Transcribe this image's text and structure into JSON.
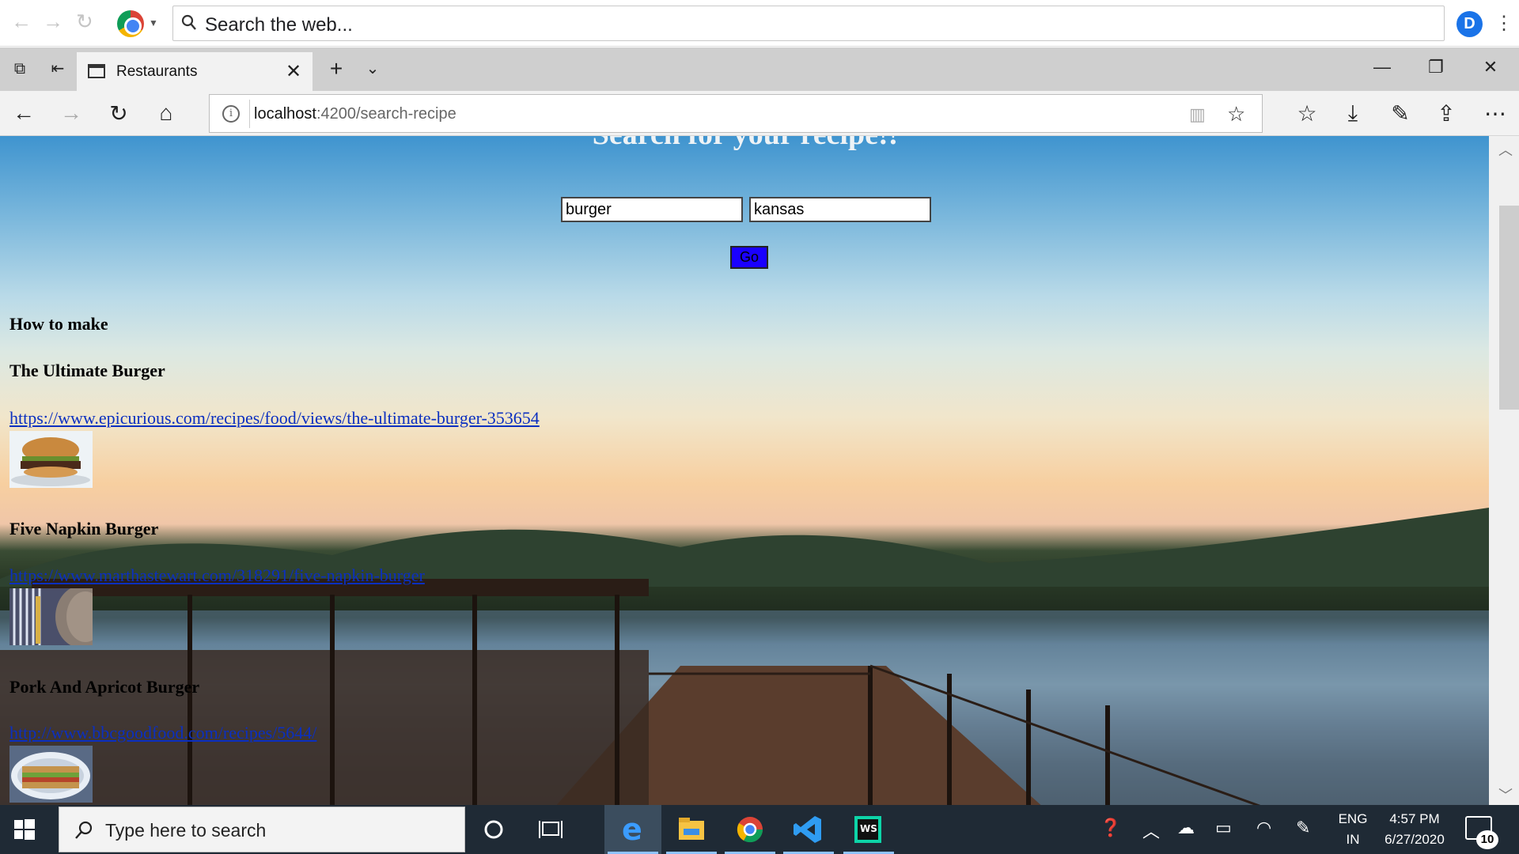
{
  "chrome": {
    "omnibox_placeholder": "Search the web...",
    "profile_initial": "D"
  },
  "tab": {
    "title": "Restaurants"
  },
  "address_bar": {
    "host": "localhost",
    "path": ":4200/search-recipe"
  },
  "page": {
    "heading": "Search for your recipe!!",
    "search": {
      "dish_value": "burger",
      "location_value": "kansas",
      "go_label": "Go"
    },
    "how_to_label": "How to make",
    "recipes": [
      {
        "title": "The Ultimate Burger",
        "url": "https://www.epicurious.com/recipes/food/views/the-ultimate-burger-353654",
        "image": "burger-photo"
      },
      {
        "title": "Five Napkin Burger",
        "url": "https://www.marthastewart.com/318291/five-napkin-burger",
        "image": "fork-plate-photo"
      },
      {
        "title": "Pork And Apricot Burger",
        "url": "http://www.bbcgoodfood.com/recipes/5644/",
        "image": "sandwich-photo"
      }
    ]
  },
  "taskbar": {
    "search_placeholder": "Type here to search",
    "lang_top": "ENG",
    "lang_bottom": "IN",
    "time": "4:57 PM",
    "date": "6/27/2020",
    "notification_count": "10"
  }
}
